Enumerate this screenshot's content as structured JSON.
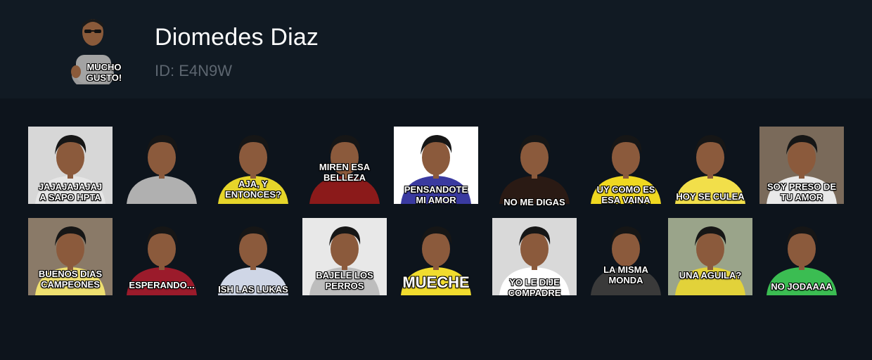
{
  "pack": {
    "title": "Diomedes Diaz",
    "id_text": "ID: E4N9W",
    "icon_caption": "MUCHO\nGUSTO!"
  },
  "stickers_row1": [
    {
      "caption": "JAJAJAJAJAJ\nA SAPO HPTA",
      "shirt": "#e6e6e6",
      "bg": "#d7d7d7"
    },
    {
      "caption": "",
      "shirt": "#b0b0b0",
      "bg": ""
    },
    {
      "caption": "AJA, Y\nENTONCES?",
      "shirt": "#e6d52a",
      "bg": ""
    },
    {
      "caption": "MIREN ESA\nBELLEZA",
      "shirt": "#8b1a1a",
      "bg": ""
    },
    {
      "caption": "PENSANDOTE\nMI AMOR",
      "shirt": "#3a3aa0",
      "bg": "#ffffff"
    },
    {
      "caption": "NO ME DIGAS",
      "shirt": "#2a1a14",
      "bg": ""
    },
    {
      "caption": "UY COMO ES\nESA VAINA",
      "shirt": "#f0d820",
      "bg": ""
    },
    {
      "caption": "HOY SE CULEA",
      "shirt": "#f2df4a",
      "bg": ""
    },
    {
      "caption": "SOY PRESO DE\nTU AMOR",
      "shirt": "#e9e9e9",
      "bg": "#7a6a5a"
    }
  ],
  "stickers_row2": [
    {
      "caption": "BUENOS DIAS\nCAMPEONES",
      "shirt": "#efe070",
      "bg": "#8a7a68"
    },
    {
      "caption": "ESPERANDO...",
      "shirt": "#9b1b2b",
      "bg": ""
    },
    {
      "caption": "ISH LAS LUKAS",
      "shirt": "#cfd6e6",
      "bg": ""
    },
    {
      "caption": "BAJELE LOS\nPERROS",
      "shirt": "#bdbdbd",
      "bg": "#e8e8e8"
    },
    {
      "caption": "MUECHE",
      "shirt": "#f1dc2e",
      "bg": ""
    },
    {
      "caption": "YO LE DIJE\nCOMPADRE",
      "shirt": "#ffffff",
      "bg": "#d9d9d9"
    },
    {
      "caption": "LA MISMA\nMONDA",
      "shirt": "#3a3a3a",
      "bg": ""
    },
    {
      "caption": "UNA AGUILA?",
      "shirt": "#e2d23a",
      "bg": "#9aa48a"
    },
    {
      "caption": "NO JODAAAA",
      "shirt": "#3bbd52",
      "bg": ""
    }
  ]
}
